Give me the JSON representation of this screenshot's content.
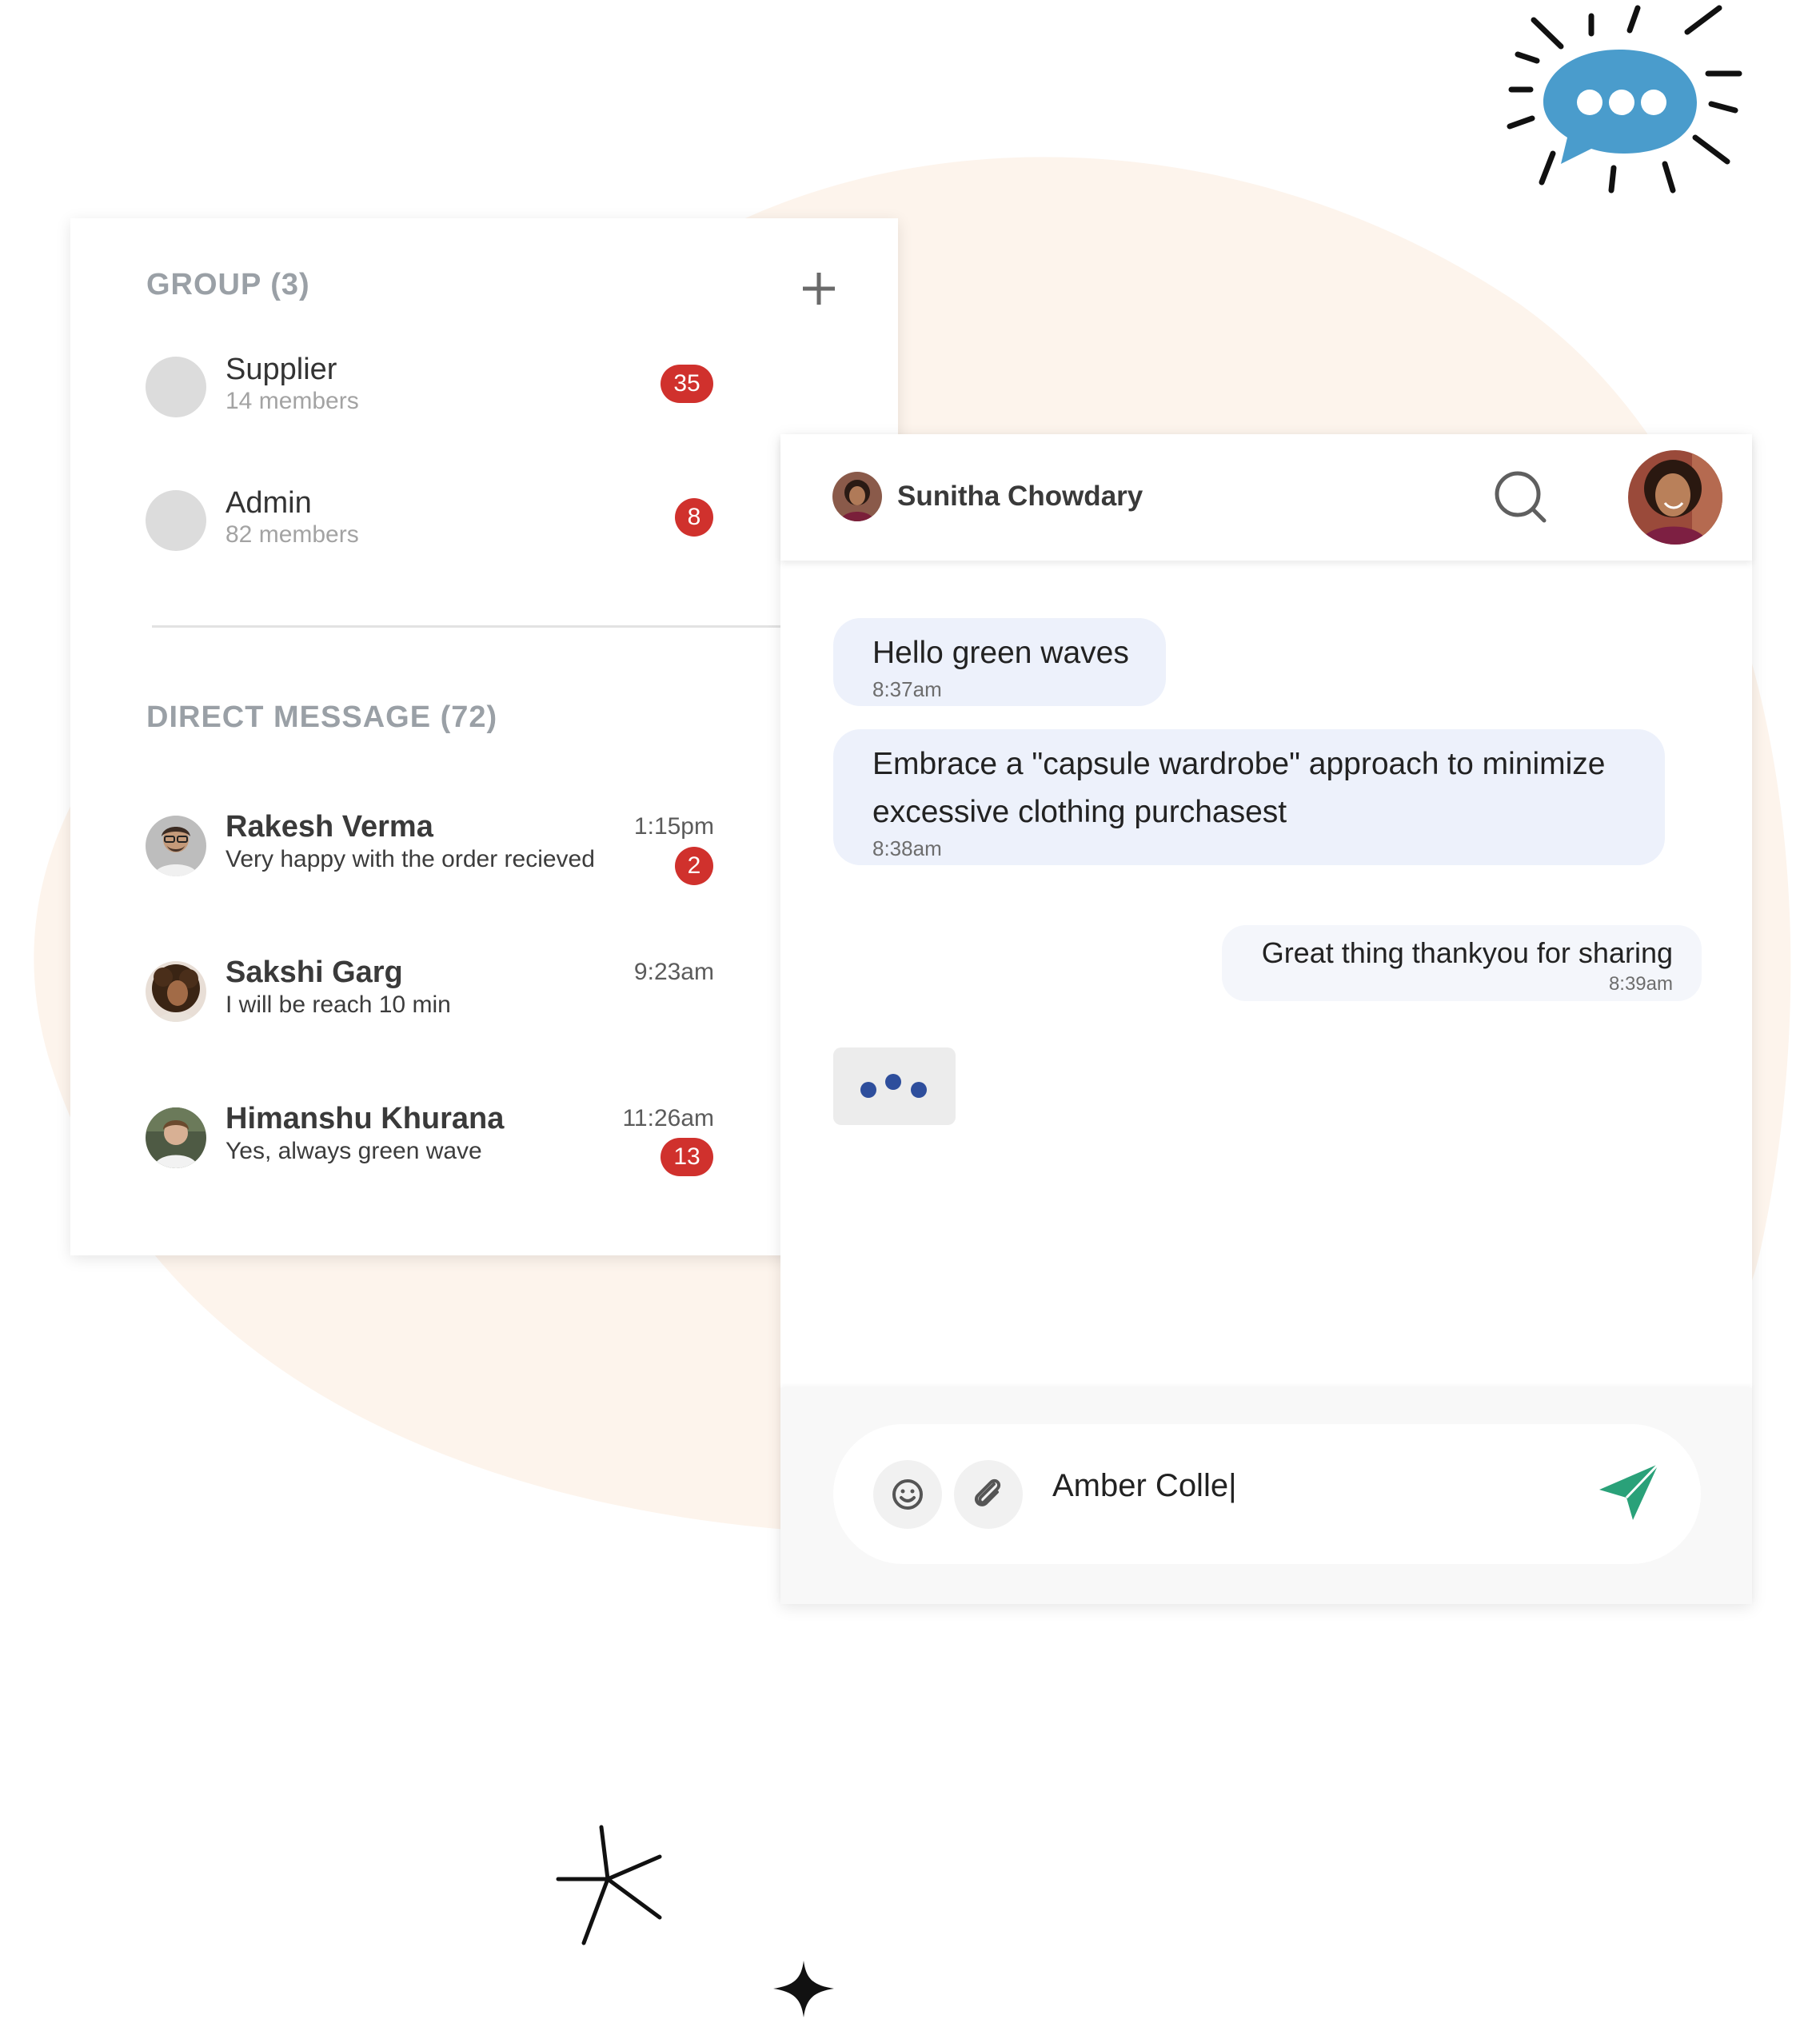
{
  "colors": {
    "blob": "#fdf4ec",
    "badge": "#d0312d",
    "bubble_in": "#edf1fb",
    "typing_dot": "#2e4e9c",
    "send": "#2aa179",
    "chat_icon": "#4a9ccc"
  },
  "groups": {
    "title": "GROUP (3)",
    "items": [
      {
        "name": "Supplier",
        "members": "14 members",
        "badge": "35"
      },
      {
        "name": "Admin",
        "members": "82 members",
        "badge": "8"
      }
    ]
  },
  "direct_messages": {
    "title": "DIRECT MESSAGE (72)",
    "items": [
      {
        "name": "Rakesh Verma",
        "preview": "Very happy with the order recieved",
        "time": "1:15pm",
        "badge": "2"
      },
      {
        "name": "Sakshi Garg",
        "preview": "I will be reach 10 min",
        "time": "9:23am",
        "badge": ""
      },
      {
        "name": "Himanshu Khurana",
        "preview": "Yes, always green wave",
        "time": "11:26am",
        "badge": "13"
      }
    ]
  },
  "chat": {
    "contact_name": "Sunitha Chowdary",
    "messages": [
      {
        "text": "Hello green waves",
        "time": "8:37am",
        "direction": "in"
      },
      {
        "text": "Embrace a \"capsule wardrobe\" approach to minimize excessive clothing purchasest",
        "time": "8:38am",
        "direction": "in"
      },
      {
        "text": "Great thing thankyou for sharing",
        "time": "8:39am",
        "direction": "out"
      }
    ],
    "composer_value": "Amber Colle|"
  },
  "icons": {
    "plus": "plus-icon",
    "search": "search-icon",
    "emoji": "emoji-icon",
    "attach": "paperclip-icon",
    "send": "send-icon",
    "chat": "chat-bubble-icon"
  }
}
